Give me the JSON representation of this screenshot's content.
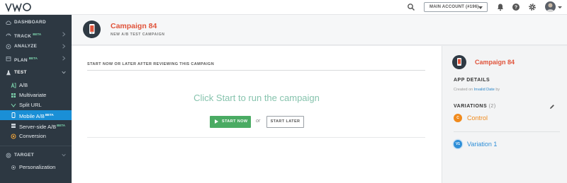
{
  "brand": {
    "logo_text": "VWO"
  },
  "topbar": {
    "account_label": "MAIN ACCOUNT (#196)",
    "icons": [
      "search-icon",
      "bell-icon",
      "help-icon",
      "gear-icon",
      "avatar"
    ]
  },
  "sidebar": {
    "items": [
      {
        "label": "DASHBOARD",
        "icon": "cloud-icon"
      },
      {
        "label": "TRACK",
        "badge": "BETA",
        "icon": "gauge-icon"
      },
      {
        "label": "ANALYZE",
        "icon": "analyze-icon"
      },
      {
        "label": "PLAN",
        "badge": "BETA",
        "icon": "plan-icon"
      },
      {
        "label": "TEST",
        "icon": "flask-icon"
      },
      {
        "label": "TARGET",
        "icon": "target-icon"
      }
    ],
    "test_subitems": [
      {
        "label": "A/B",
        "icon": "ab-icon"
      },
      {
        "label": "Multivariate",
        "icon": "grid-icon"
      },
      {
        "label": "Split URL",
        "icon": "split-icon"
      },
      {
        "label": "Mobile A/B",
        "badge": "BETA",
        "icon": "mobile-icon",
        "active": true
      },
      {
        "label": "Server-side A/B",
        "badge": "BETA",
        "icon": "server-icon"
      },
      {
        "label": "Conversion",
        "icon": "conversion-icon"
      }
    ],
    "target_subitems": [
      {
        "label": "Personalization",
        "icon": "personalization-icon"
      }
    ]
  },
  "header": {
    "title": "Campaign 84",
    "subtitle": "NEW A/B TEST CAMPAIGN"
  },
  "main": {
    "section_label": "START NOW OR LATER AFTER REVIEWING THIS CAMPAIGN",
    "prompt": "Click Start to run the campaign",
    "start_now_label": "START NOW",
    "or_label": "or",
    "start_later_label": "START LATER"
  },
  "panel": {
    "title": "Campaign 84",
    "details_heading": "APP DETAILS",
    "created_prefix": "Created on",
    "created_link": "Invalid Date",
    "created_suffix": "by",
    "variations_heading": "VARIATIONS",
    "variations_count": "(2)",
    "variations": [
      {
        "badge": "C",
        "label": "Control",
        "color": "#f08a1c"
      },
      {
        "badge": "V1",
        "label": "Variation 1",
        "color": "#2f8fd8"
      }
    ]
  },
  "colors": {
    "accent_red": "#e0533a",
    "active_blue": "#1a8fd6",
    "start_green": "#4aab63",
    "sidebar_bg": "#2d3842"
  }
}
